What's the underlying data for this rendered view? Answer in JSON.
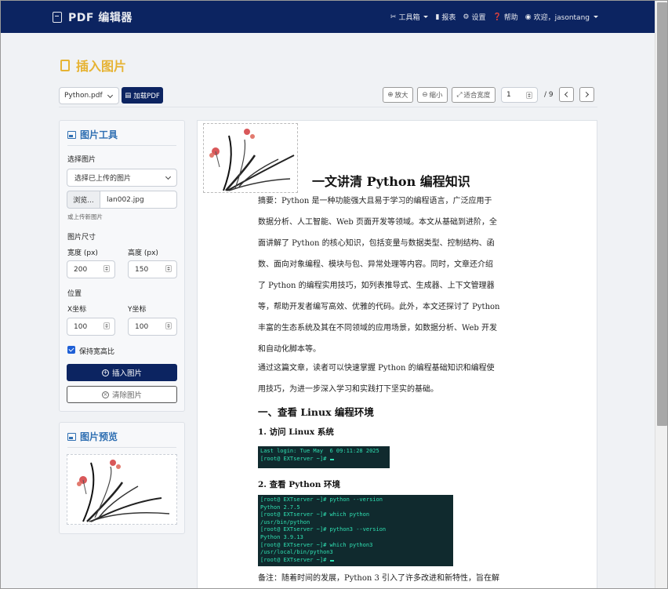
{
  "navbar": {
    "brand": "PDF 编辑器",
    "tools": "工具箱",
    "reports": "报表",
    "settings": "设置",
    "help": "帮助",
    "user": "欢迎，jasontang"
  },
  "page": {
    "title": "插入图片"
  },
  "toolbar": {
    "file_select": "Python.pdf",
    "load_button": "加载PDF",
    "zoom_in": "放大",
    "zoom_out": "缩小",
    "fit_width": "适合宽度",
    "current_page": "1",
    "total_pages": "/ 9"
  },
  "image_tools": {
    "title": "图片工具",
    "select_label": "选择图片",
    "select_value": "选择已上传的图片",
    "browse_label": "浏览...",
    "file_name": "lan002.jpg",
    "upload_hint": "或上传新图片",
    "size_label": "图片尺寸",
    "width_label": "宽度 (px)",
    "width_value": "200",
    "height_label": "高度 (px)",
    "height_value": "150",
    "position_label": "位置",
    "x_label": "X坐标",
    "x_value": "100",
    "y_label": "Y坐标",
    "y_value": "100",
    "keep_ratio": "保持宽高比",
    "keep_ratio_checked": true,
    "insert_button": "插入图片",
    "clear_button": "清除图片"
  },
  "image_preview": {
    "title": "图片预览"
  },
  "document": {
    "title": "一文讲清 Python 编程知识",
    "abstract_lines": [
      "摘要：Python  是一种功能强大且易于学习的编程语言，广泛应用于",
      "数据分析、人工智能、Web 页面开发等领域。本文从基础到进阶，全",
      "面讲解了 Python 的核心知识，包括变量与数据类型、控制结构、函",
      "数、面向对象编程、模块与包、异常处理等内容。同时，文章还介绍",
      "了 Python 的编程实用技巧，如列表推导式、生成器、上下文管理器",
      "等，帮助开发者编写高效、优雅的代码。此外，本文还探讨了 Python",
      "丰富的生态系统及其在不同领域的应用场景，如数据分析、Web 开发",
      "和自动化脚本等。"
    ],
    "intro_lines": [
      "通过这篇文章，读者可以快速掌握 Python 的编程基础知识和编程使",
      "用技巧，为进一步深入学习和实践打下坚实的基础。"
    ],
    "section1": "一、查看 Linux 编程环境",
    "sub1": "1. 访问 Linux 系统",
    "term1": [
      "Last login: Tue May  6 09:11:28 2025",
      "[root@ EXTserver ~]# "
    ],
    "sub2": "2. 查看 Python 环境",
    "term2": [
      "[root@ EXTserver ~]# python --version",
      "Python 2.7.5",
      "[root@ EXTserver ~]# which python",
      "/usr/bin/python",
      "[root@ EXTserver ~]# python3 --version",
      "Python 3.9.13",
      "[root@ EXTserver ~]# which python3",
      "/usr/local/bin/python3",
      "[root@ EXTserver ~]# "
    ],
    "note": "备注：随着时间的发展，Python 3 引入了许多改进和新特性，旨在解"
  },
  "colors": {
    "navbar": "#0c2461",
    "accent_title": "#e6b333",
    "panel_title": "#2f6fb2",
    "terminal_bg": "#102a2e",
    "terminal_fg": "#2fe0b2"
  },
  "icons": {
    "brand": "pdf-file-icon",
    "tools": "wrench-icon",
    "reports": "bar-chart-icon",
    "settings": "gear-icon",
    "help": "question-circle-icon",
    "user": "user-circle-icon",
    "image_tools": "image-icon",
    "preview": "image-icon"
  }
}
